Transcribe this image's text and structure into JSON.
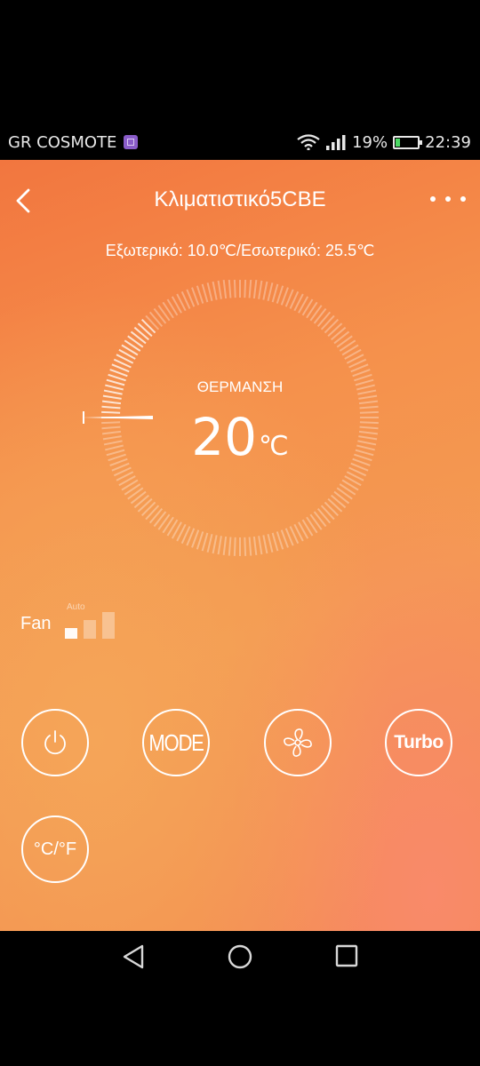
{
  "status_bar": {
    "carrier": "GR COSMOTE",
    "battery_percent": "19%",
    "battery_level": 0.19,
    "time": "22:39",
    "icons": [
      "wifi-icon",
      "signal-icon",
      "battery-charging-icon"
    ]
  },
  "header": {
    "title": "Κλιματιστικό5CBE",
    "back_icon": "chevron-left-icon",
    "menu_icon": "more-dots-icon"
  },
  "temperatures": {
    "line": "Εξωτερικό: 10.0℃/Εσωτερικό: 25.5℃"
  },
  "dial": {
    "mode": "ΘΕΡΜΑΝΣΗ",
    "setpoint": "20",
    "unit": "℃"
  },
  "fan": {
    "label": "Fan",
    "auto_label": "Auto",
    "level": 1,
    "levels": 3
  },
  "controls": {
    "power_icon": "power-icon",
    "mode_label": "MODE",
    "fan_icon": "fan-icon",
    "turbo_label": "Turbo",
    "unit_label": "°C/°F"
  },
  "nav": {
    "icons": [
      "back-triangle-icon",
      "home-circle-icon",
      "recents-square-icon"
    ]
  },
  "colors": {
    "background_start": "#f2763f",
    "background_end": "#f5914c",
    "foreground": "#ffffff"
  }
}
